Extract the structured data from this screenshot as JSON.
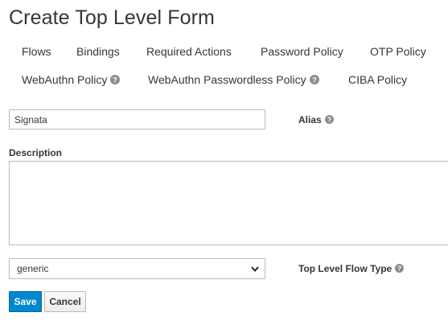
{
  "page": {
    "title": "Create Top Level Form"
  },
  "tabs": {
    "row1": [
      "Flows",
      "Bindings",
      "Required Actions",
      "Password Policy",
      "OTP Policy"
    ],
    "row2": [
      "WebAuthn Policy",
      "WebAuthn Passwordless Policy",
      "CIBA Policy"
    ]
  },
  "form": {
    "alias_value": "Signata",
    "alias_label": "Alias",
    "description_label": "Description",
    "description_value": "",
    "flow_type_value": "generic",
    "flow_type_label": "Top Level Flow Type"
  },
  "buttons": {
    "save": "Save",
    "cancel": "Cancel"
  },
  "colors": {
    "primary": "#0088ce",
    "text": "#363636",
    "border": "#bbbbbb"
  }
}
